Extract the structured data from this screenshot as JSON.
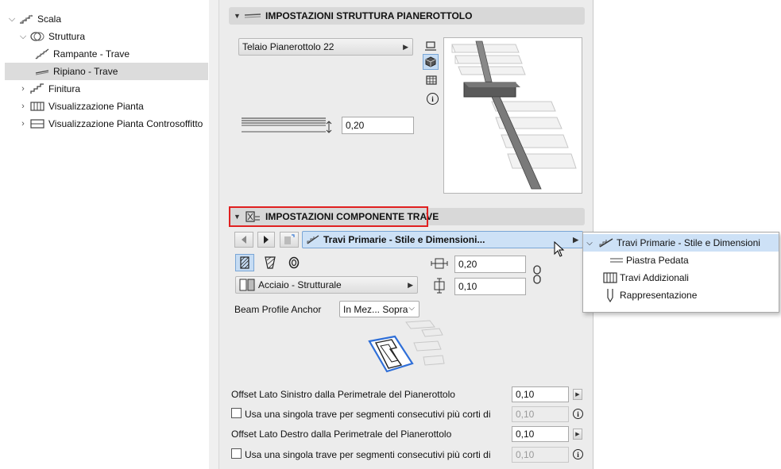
{
  "tree": {
    "items": [
      {
        "label": "Scala",
        "icon": "stair-icon"
      },
      {
        "label": "Struttura",
        "icon": "structure-icon"
      },
      {
        "label": "Rampante - Trave",
        "icon": "flight-beam-icon"
      },
      {
        "label": "Ripiano - Trave",
        "icon": "landing-beam-icon"
      },
      {
        "label": "Finitura",
        "icon": "finish-icon"
      },
      {
        "label": "Visualizzazione Pianta",
        "icon": "floor-plan-icon"
      },
      {
        "label": "Visualizzazione Pianta Controsoffitto",
        "icon": "ceiling-plan-icon"
      }
    ]
  },
  "landing_structure": {
    "title": "IMPOSTAZIONI STRUTTURA PIANEROTTOLO",
    "frame_dropdown": "Telaio Pianerottolo 22",
    "thickness_value": "0,20"
  },
  "beam_component": {
    "title": "IMPOSTAZIONI COMPONENTE TRAVE",
    "component_selector": "Travi Primarie - Stile e Dimensioni...",
    "material_dropdown": "Acciaio - Strutturale",
    "width_value": "0,20",
    "height_value": "0,10",
    "anchor_label": "Beam Profile Anchor",
    "anchor_value": "In Mez... Sopra",
    "left_offset_label": "Offset Lato Sinistro dalla Perimetrale del Pianerottolo",
    "left_offset_value": "0,10",
    "left_single_beam_label": "Usa una singola trave per segmenti consecutivi più corti di",
    "left_single_beam_value": "0,10",
    "right_offset_label": "Offset Lato Destro dalla Perimetrale del Pianerottolo",
    "right_offset_value": "0,10",
    "right_single_beam_label": "Usa una singola trave per segmenti consecutivi più corti di",
    "right_single_beam_value": "0,10"
  },
  "popup_menu": {
    "items": [
      {
        "label": "Travi Primarie - Stile e Dimensioni",
        "selected": true
      },
      {
        "label": "Piastra Pedata",
        "selected": false
      },
      {
        "label": "Travi Addizionali",
        "selected": false
      },
      {
        "label": "Rappresentazione",
        "selected": false
      }
    ]
  },
  "colors": {
    "selection_blue": "#cde1f6",
    "highlight_red": "#e02020",
    "panel_bg": "#ececec"
  }
}
